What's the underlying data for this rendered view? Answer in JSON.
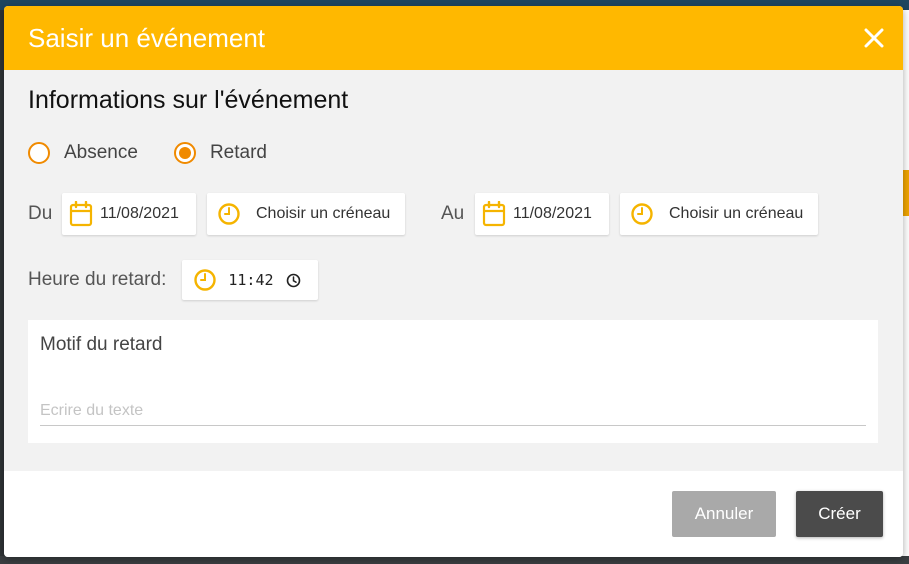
{
  "modal": {
    "title": "Saisir un événement",
    "section_title": "Informations sur l'événement"
  },
  "event_type": {
    "options": [
      {
        "label": "Absence",
        "selected": false
      },
      {
        "label": "Retard",
        "selected": true
      }
    ]
  },
  "dates": {
    "from_label": "Du",
    "from_date": "11/08/2021",
    "from_slot": "Choisir un créneau",
    "to_label": "Au",
    "to_date": "11/08/2021",
    "to_slot": "Choisir un créneau"
  },
  "lateness": {
    "label": "Heure du retard:",
    "time": "11:42"
  },
  "reason": {
    "label": "Motif du retard",
    "placeholder": "Ecrire du texte",
    "value": ""
  },
  "footer": {
    "cancel_label": "Annuler",
    "create_label": "Créer"
  },
  "colors": {
    "header": "#ffb800",
    "accent": "#f08a00",
    "icon": "#f5b400",
    "cancel": "#a9a9a9",
    "create": "#4b4b4b"
  },
  "icons": [
    "close-icon",
    "calendar-icon",
    "clock-icon"
  ]
}
